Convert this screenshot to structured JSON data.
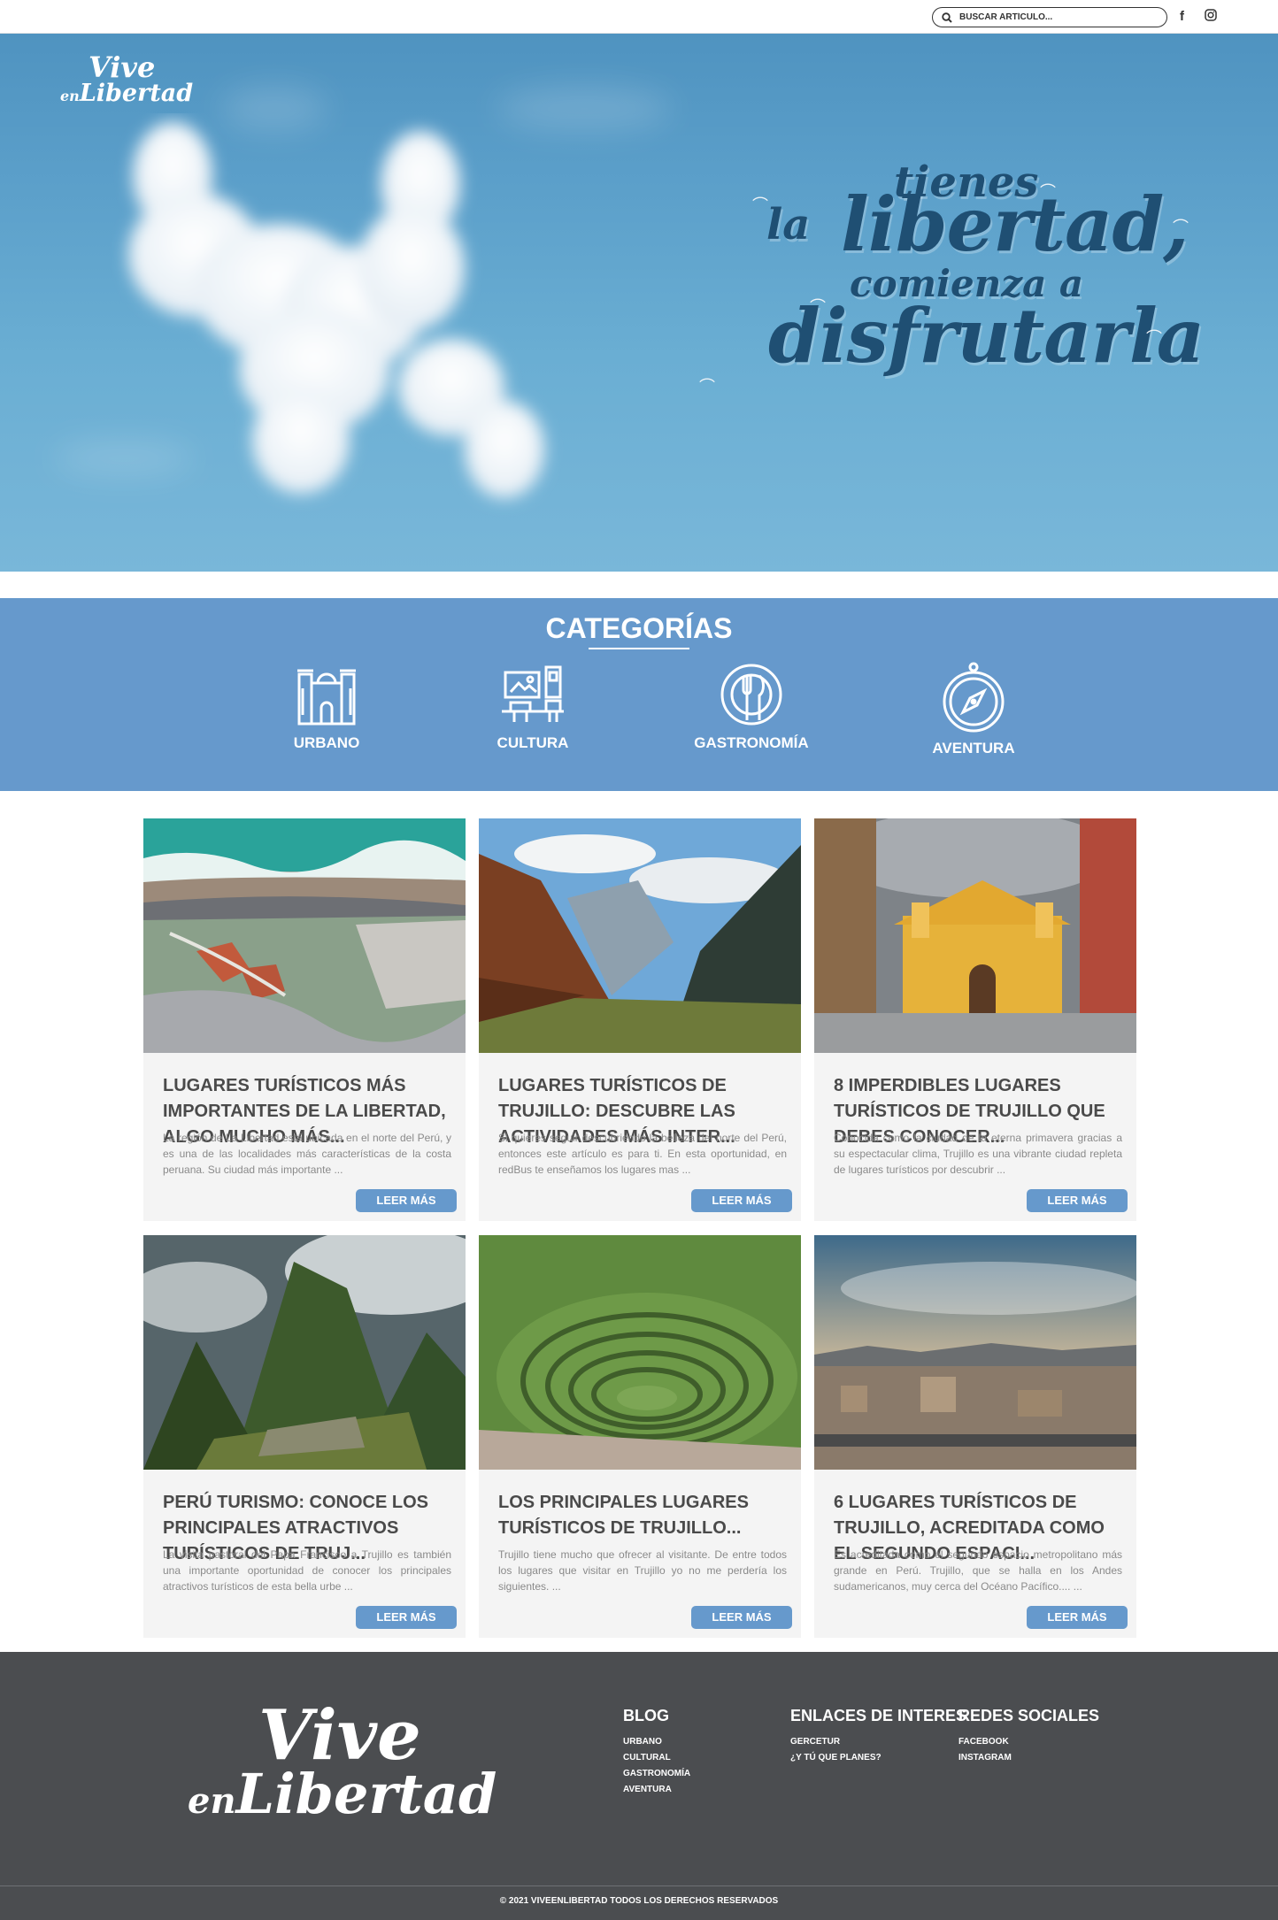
{
  "colors": {
    "accent": "#6699cc",
    "footer_bg": "#4b4d50",
    "card_bg": "#f4f4f4",
    "sky": "#5a9ec9",
    "tagline": "#1f4f73"
  },
  "topbar": {
    "search_placeholder": "BUSCAR ARTÍCULO...",
    "search_icon": "search-icon",
    "facebook_icon_glyph": "f",
    "instagram_icon_glyph": "◎"
  },
  "hero": {
    "logo_top": "Vive",
    "logo_en": "en",
    "logo_bottom": "Libertad",
    "tagline": {
      "line1": "tienes",
      "line2a": "la",
      "line2b": "libertad,",
      "line3": "comienza a",
      "line4": "disfrutarla"
    }
  },
  "categories": {
    "title": "CATEGORÍAS",
    "items": [
      {
        "label": "URBANO",
        "icon": "building-icon"
      },
      {
        "label": "CULTURA",
        "icon": "museum-icon"
      },
      {
        "label": "GASTRONOMÍA",
        "icon": "plate-icon"
      },
      {
        "label": "AVENTURA",
        "icon": "compass-icon"
      }
    ]
  },
  "articles": [
    {
      "title": "LUGARES TURÍSTICOS MÁS IMPORTANTES DE LA LIBERTAD, ALGO MUCHO MÁS...",
      "excerpt": "La región de La Libertad está ubicada en el norte del Perú, y es una de las localidades más características de la costa peruana. Su ciudad más importante ...",
      "button": "LEER MÁS"
    },
    {
      "title": "LUGARES TURÍSTICOS DE TRUJILLO: DESCUBRE LAS ACTIVIDADES MÁS INTER...",
      "excerpt": "Si quieres seguir descubriendo la belleza del norte del Perú, entonces este artículo es para ti. En esta oportunidad, en redBus te enseñamos los lugares mas ...",
      "button": "LEER MÁS"
    },
    {
      "title": "8 IMPERDIBLES LUGARES TURÍSTICOS DE TRUJILLO QUE DEBES CONOCER...",
      "excerpt": "Conocida como la ciudad de la eterna primavera gracias a su espectacular clima, Trujillo es una vibrante ciudad repleta de lugares turísticos por descubrir ...",
      "button": "LEER MÁS"
    },
    {
      "title": "PERÚ TURISMO: CONOCE LOS PRINCIPALES ATRACTIVOS TURÍSTICOS DE TRUJ...",
      "excerpt": "La visita pastoral del Papa Francisco a Trujillo es también una importante oportunidad de conocer los principales atractivos turísticos de esta bella urbe ...",
      "button": "LEER MÁS"
    },
    {
      "title": "LOS PRINCIPALES LUGARES TURÍSTICOS DE TRUJILLO...",
      "excerpt": "Trujillo tiene mucho que ofrecer al visitante. De entre todos los lugares que visitar en Trujillo yo no me perdería los siguientes. ...",
      "button": "LEER MÁS"
    },
    {
      "title": "6 LUGARES TURÍSTICOS DE TRUJILLO, ACREDITADA COMO EL SEGUNDO ESPACI...",
      "excerpt": "Es acreditada como el segundo espacio metropolitano más grande en Perú. Trujillo, que se halla en los Andes sudamericanos, muy cerca del Océano Pacífico.... ...",
      "button": "LEER MÁS"
    }
  ],
  "footer": {
    "logo_top": "Vive",
    "logo_en": "en",
    "logo_bottom": "Libertad",
    "columns": [
      {
        "heading": "BLOG",
        "links": [
          "URBANO",
          "CULTURAL",
          "GASTRONOMÍA",
          "AVENTURA"
        ]
      },
      {
        "heading": "ENLACES DE INTERES",
        "links": [
          "GERCETUR",
          "¿Y TÚ QUE PLANES?"
        ]
      },
      {
        "heading": "REDES SOCIALES",
        "links": [
          "FACEBOOK",
          "INSTAGRAM"
        ]
      }
    ],
    "copyright": "© 2021 VIVEENLIBERTAD TODOS LOS DERECHOS RESERVADOS"
  }
}
